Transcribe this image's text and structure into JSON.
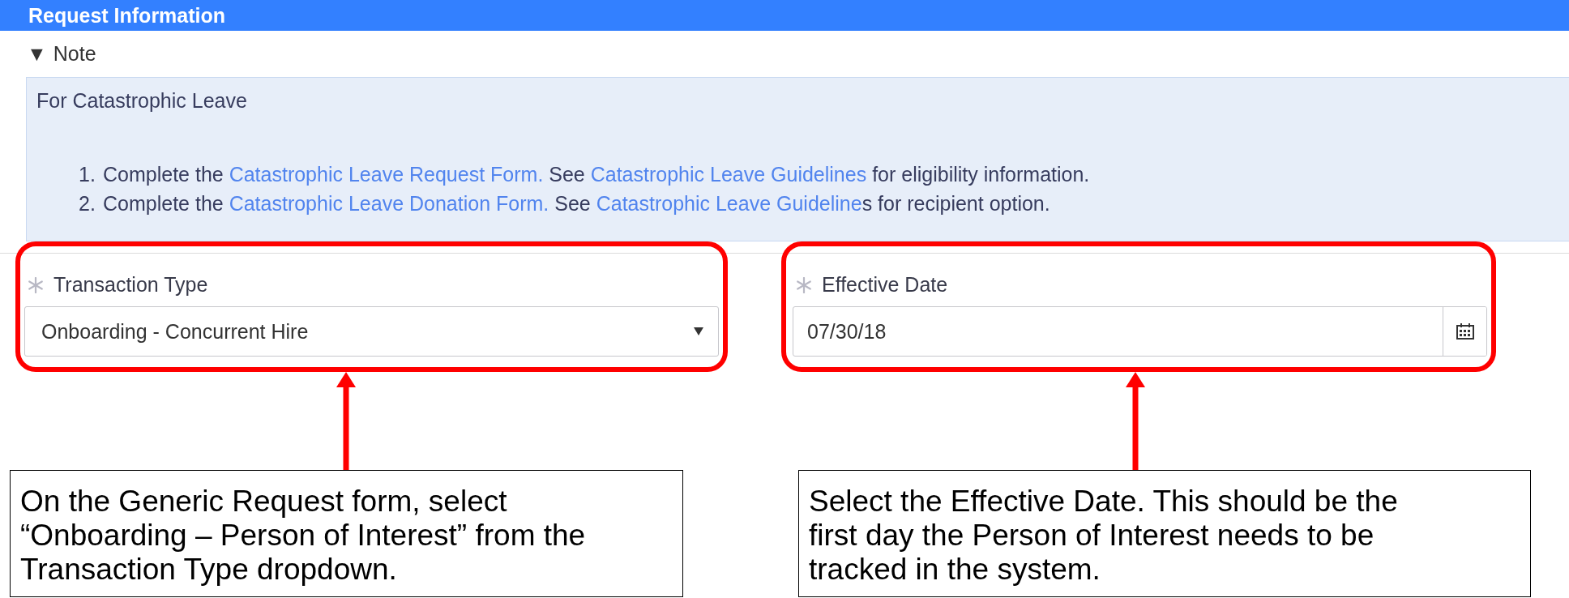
{
  "header": {
    "title": "Request Information"
  },
  "note": {
    "toggle": "▼",
    "label": "Note",
    "expanded": true,
    "heading": "For Catastrophic Leave",
    "items": [
      {
        "number": "1.",
        "segments": [
          {
            "kind": "plain",
            "text": "Complete the "
          },
          {
            "kind": "link",
            "text": "Catastrophic Leave Request Form."
          },
          {
            "kind": "plain",
            "text": " See "
          },
          {
            "kind": "link",
            "text": "Catastrophic Leave Guidelines"
          },
          {
            "kind": "plain",
            "text": " for eligibility information."
          }
        ]
      },
      {
        "number": "2.",
        "segments": [
          {
            "kind": "plain",
            "text": "Complete the "
          },
          {
            "kind": "link",
            "text": "Catastrophic Leave Donation Form."
          },
          {
            "kind": "plain",
            "text": " See "
          },
          {
            "kind": "link",
            "text": "Catastrophic Leave Guideline"
          },
          {
            "kind": "plain",
            "text": "s for recipient option."
          }
        ]
      }
    ]
  },
  "fields": [
    {
      "kind": "select",
      "label": "Transaction Type",
      "required": true,
      "value": "Onboarding - Concurrent Hire"
    },
    {
      "kind": "date",
      "label": "Effective Date",
      "required": true,
      "value": "07/30/18"
    }
  ],
  "callouts": [
    {
      "lines": [
        "On the Generic Request form, select",
        "“Onboarding – Person of Interest” from the",
        "Transaction Type dropdown."
      ]
    },
    {
      "lines": [
        "Select the Effective Date. This should be the",
        "first day the Person of Interest needs to be",
        "tracked in the system."
      ]
    }
  ]
}
